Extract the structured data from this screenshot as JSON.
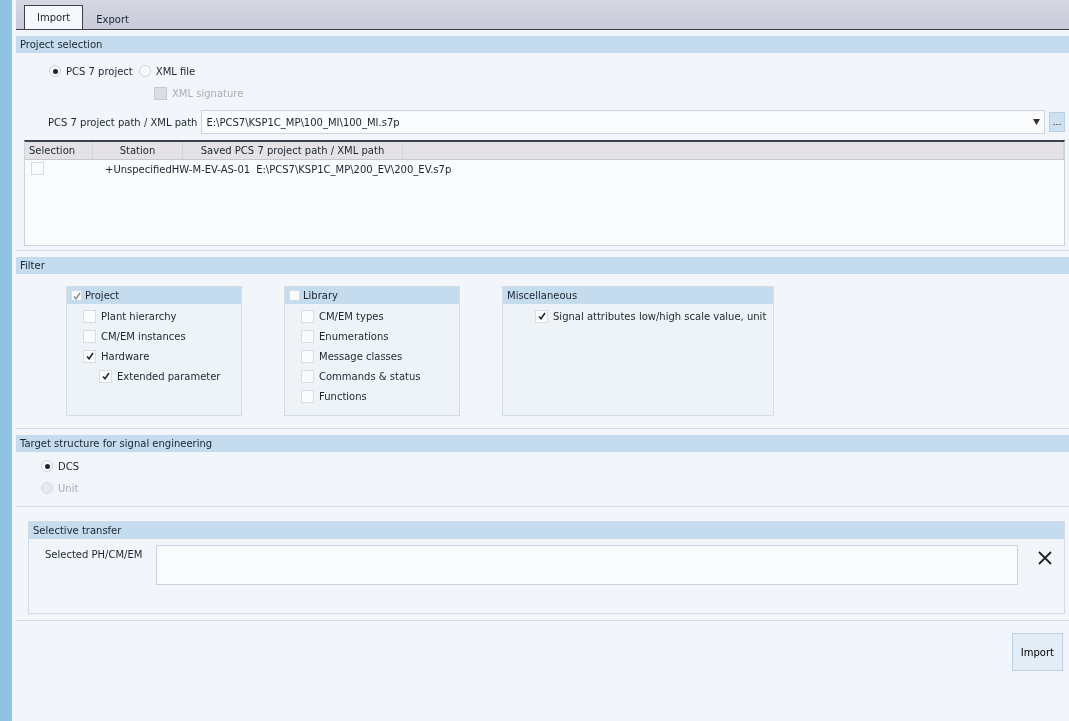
{
  "tabs": [
    {
      "label": "Import",
      "selected": true
    },
    {
      "label": "Export",
      "selected": false
    }
  ],
  "project_selection": {
    "title": "Project selection",
    "source_options": [
      {
        "label": "PCS 7 project",
        "selected": true,
        "disabled": false
      },
      {
        "label": "XML file",
        "selected": false,
        "disabled": false
      }
    ],
    "xml_signature": {
      "label": "XML signature",
      "checked": false,
      "disabled": true
    },
    "path": {
      "label": "PCS 7 project path / XML path",
      "value": "E:\\PCS7\\KSP1C_MP\\100_MI\\100_MI.s7p",
      "browse": "..."
    },
    "table": {
      "columns": [
        "Selection",
        "Station",
        "Saved PCS 7 project path / XML path"
      ],
      "rows": [
        {
          "checked": false,
          "station": "+UnspecifiedHW-M-EV-AS-01",
          "path": "E:\\PCS7\\KSP1C_MP\\200_EV\\200_EV.s7p"
        }
      ]
    }
  },
  "filter": {
    "title": "Filter",
    "groups": [
      {
        "title": "Project",
        "checked": true,
        "items": [
          {
            "label": "Plant hierarchy",
            "checked": false
          },
          {
            "label": "CM/EM instances",
            "checked": false
          },
          {
            "label": "Hardware",
            "checked": true,
            "children": [
              {
                "label": "Extended parameter",
                "checked": true
              }
            ]
          }
        ]
      },
      {
        "title": "Library",
        "checked": false,
        "items": [
          {
            "label": "CM/EM types",
            "checked": false
          },
          {
            "label": "Enumerations",
            "checked": false
          },
          {
            "label": "Message classes",
            "checked": false
          },
          {
            "label": "Commands & status",
            "checked": false
          },
          {
            "label": "Functions",
            "checked": false
          }
        ]
      },
      {
        "title": "Miscellaneous",
        "items": [
          {
            "label": "Signal attributes low/high scale value, unit",
            "checked": true
          }
        ]
      }
    ]
  },
  "target_structure": {
    "title": "Target structure for signal engineering",
    "options": [
      {
        "label": "DCS",
        "selected": true,
        "disabled": false
      },
      {
        "label": "Unit",
        "selected": false,
        "disabled": true
      }
    ]
  },
  "selective_transfer": {
    "title": "Selective transfer",
    "label": "Selected PH/CM/EM"
  },
  "import_button": "Import"
}
